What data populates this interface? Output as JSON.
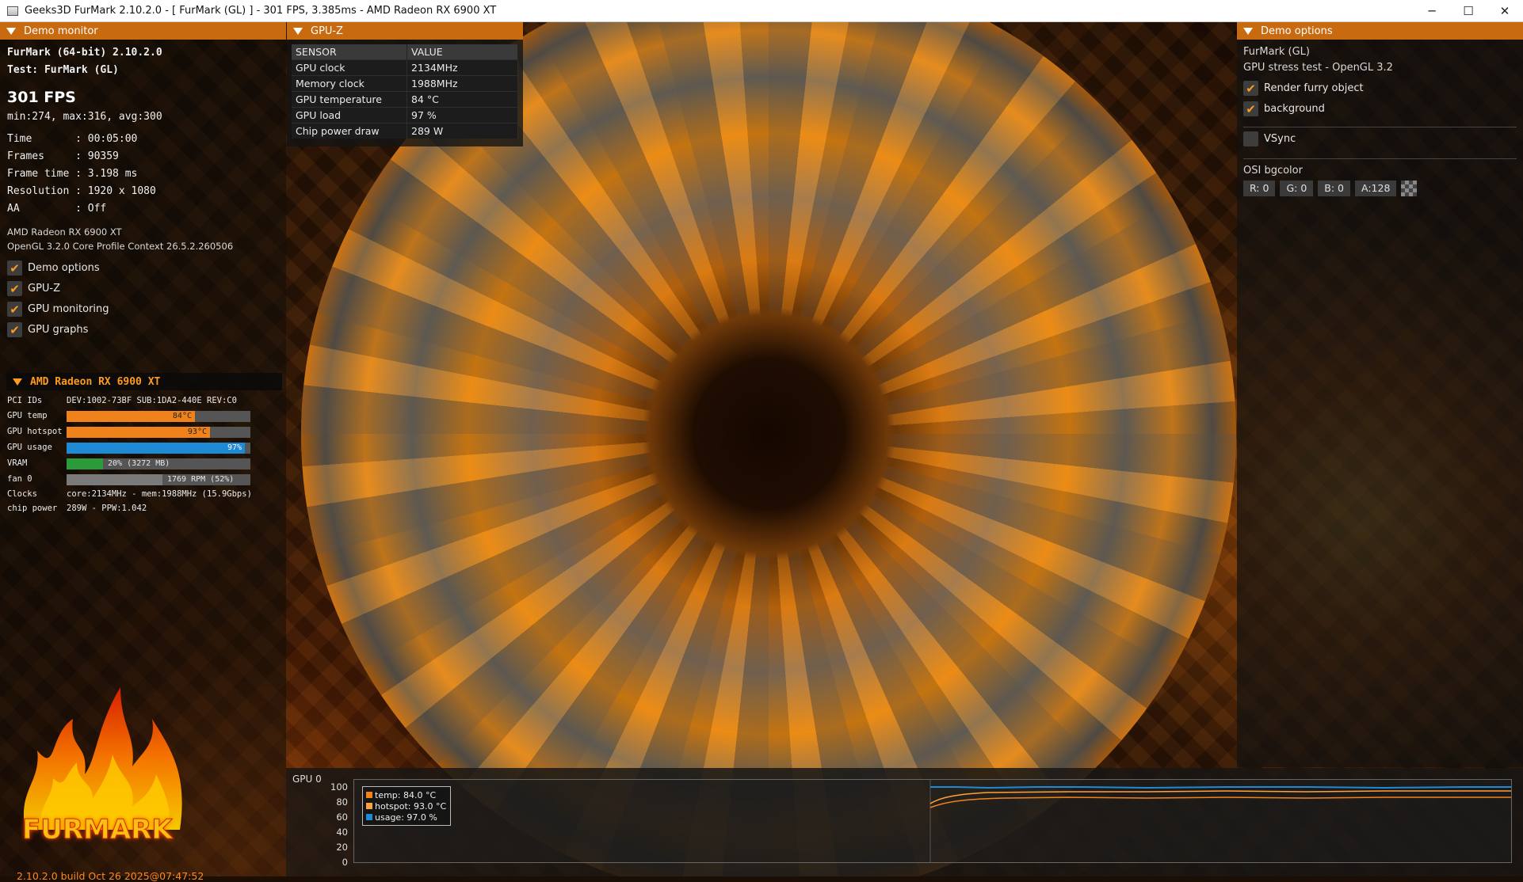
{
  "window": {
    "title": "Geeks3D FurMark 2.10.2.0 - [ FurMark (GL) ] - 301 FPS, 3.385ms - AMD Radeon RX 6900 XT",
    "minimize": "─",
    "maximize": "☐",
    "close": "✕"
  },
  "demo_monitor": {
    "header": "Demo monitor",
    "app_line": "FurMark (64-bit) 2.10.2.0",
    "test_line": "Test: FurMark (GL)",
    "fps": "301 FPS",
    "fps_stats": "min:274, max:316, avg:300",
    "stats": [
      "Time       : 00:05:00",
      "Frames     : 90359",
      "Frame time : 3.198 ms",
      "Resolution : 1920 x 1080",
      "AA         : Off"
    ],
    "gpu_name": "AMD Radeon RX 6900 XT",
    "gl_context": "OpenGL 3.2.0 Core Profile Context 26.5.2.260506",
    "toggles": [
      {
        "label": "Demo options",
        "checked": true
      },
      {
        "label": "GPU-Z",
        "checked": true
      },
      {
        "label": "GPU monitoring",
        "checked": true
      },
      {
        "label": "GPU graphs",
        "checked": true
      }
    ],
    "gpu_section": {
      "title": "AMD Radeon RX 6900 XT",
      "pci_label": "PCI IDs",
      "pci_value": "DEV:1002-73BF SUB:1DA2-440E REV:C0",
      "bars": [
        {
          "label": "GPU temp",
          "text": "84°C",
          "fraction": 0.7,
          "color": "#f0821c"
        },
        {
          "label": "GPU hotspot",
          "text": "93°C",
          "fraction": 0.78,
          "color": "#f0821c"
        },
        {
          "label": "GPU usage",
          "text": "97%",
          "fraction": 0.97,
          "color": "#1e8ad6"
        },
        {
          "label": "VRAM",
          "text": "20% (3272 MB)",
          "fraction": 0.2,
          "color": "#2a9a3a"
        },
        {
          "label": "fan 0",
          "text": "1769 RPM (52%)",
          "fraction": 0.52,
          "color": "#7a7a7a"
        }
      ],
      "clocks_label": "Clocks",
      "clocks_value": "core:2134MHz - mem:1988MHz (15.9Gbps)",
      "power_label": "chip power",
      "power_value": "289W - PPW:1.042"
    },
    "logo_text": "FURMARK",
    "build": "2.10.2.0 build Oct 26 2025@07:47:52"
  },
  "gpuz": {
    "header": "GPU-Z",
    "col_sensor": "SENSOR",
    "col_value": "VALUE",
    "rows": [
      {
        "sensor": "GPU clock",
        "value": "2134MHz"
      },
      {
        "sensor": "Memory clock",
        "value": "1988MHz"
      },
      {
        "sensor": "GPU temperature",
        "value": "84 °C"
      },
      {
        "sensor": "GPU load",
        "value": "97 %"
      },
      {
        "sensor": "Chip power draw",
        "value": "289 W"
      }
    ]
  },
  "demo_options": {
    "header": "Demo options",
    "name": "FurMark (GL)",
    "desc": "GPU stress test - OpenGL 3.2",
    "render_furry": {
      "label": "Render furry object",
      "checked": true
    },
    "background": {
      "label": "background",
      "checked": true
    },
    "vsync": {
      "label": "VSync",
      "checked": false
    },
    "osi_label": "OSI bgcolor",
    "rgba": [
      "R: 0",
      "G: 0",
      "B: 0",
      "A:128"
    ]
  },
  "gpu_graph": {
    "title": "GPU 0",
    "legend": [
      {
        "label": "temp: 84.0 °C",
        "color": "#f0821c"
      },
      {
        "label": "hotspot: 93.0 °C",
        "color": "#ffa040"
      },
      {
        "label": "usage: 97.0 %",
        "color": "#1e8ad6"
      }
    ],
    "yticks": [
      "100",
      "80",
      "60",
      "40",
      "20",
      "0"
    ]
  }
}
